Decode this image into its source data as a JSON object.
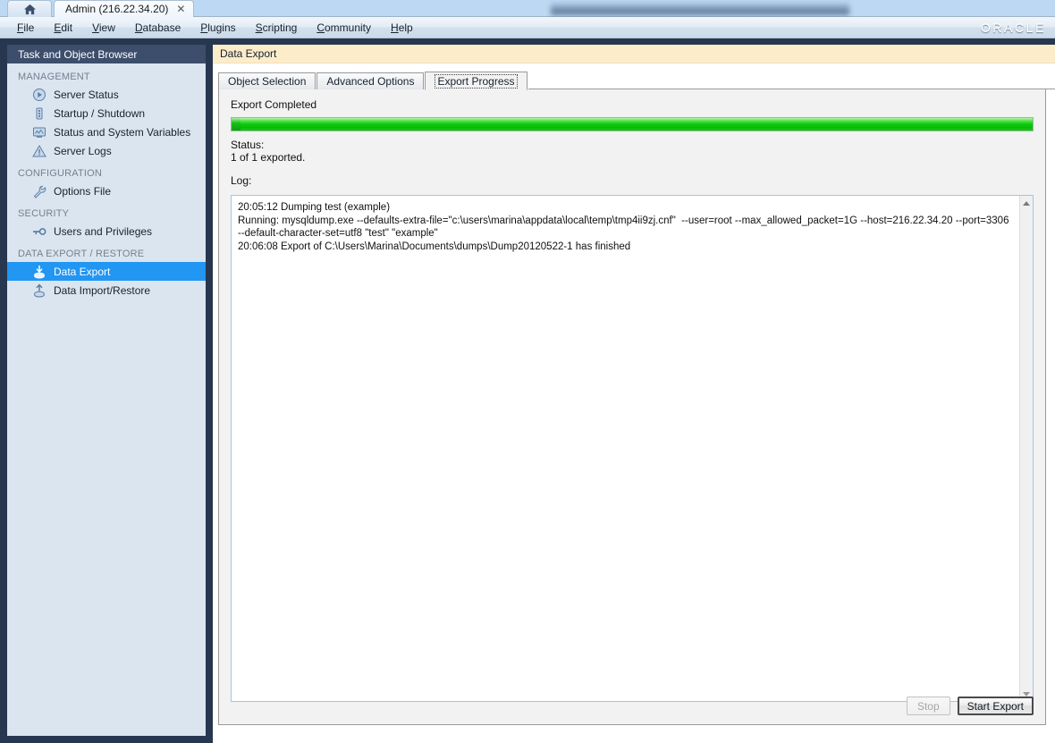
{
  "window": {
    "home_tab_icon": "home-icon",
    "document_tab_label": "Admin (216.22.34.20)",
    "tab_close_glyph": "✕"
  },
  "menubar": {
    "items": [
      {
        "pre": "",
        "accel": "F",
        "post": "ile"
      },
      {
        "pre": "",
        "accel": "E",
        "post": "dit"
      },
      {
        "pre": "",
        "accel": "V",
        "post": "iew"
      },
      {
        "pre": "",
        "accel": "D",
        "post": "atabase"
      },
      {
        "pre": "",
        "accel": "P",
        "post": "lugins"
      },
      {
        "pre": "",
        "accel": "S",
        "post": "cripting"
      },
      {
        "pre": "",
        "accel": "C",
        "post": "ommunity"
      },
      {
        "pre": "",
        "accel": "H",
        "post": "elp"
      }
    ],
    "brand": "ORACLE"
  },
  "sidebar": {
    "header": "Task and Object Browser",
    "sections": [
      {
        "label": "MANAGEMENT",
        "items": [
          {
            "label": "Server Status",
            "icon": "play-circle-icon",
            "selected": false
          },
          {
            "label": "Startup / Shutdown",
            "icon": "server-stack-icon",
            "selected": false
          },
          {
            "label": "Status and System Variables",
            "icon": "monitor-icon",
            "selected": false
          },
          {
            "label": "Server Logs",
            "icon": "warning-triangle-icon",
            "selected": false
          }
        ]
      },
      {
        "label": "CONFIGURATION",
        "items": [
          {
            "label": "Options File",
            "icon": "wrench-icon",
            "selected": false
          }
        ]
      },
      {
        "label": "SECURITY",
        "items": [
          {
            "label": "Users and Privileges",
            "icon": "key-icon",
            "selected": false
          }
        ]
      },
      {
        "label": "DATA EXPORT / RESTORE",
        "items": [
          {
            "label": "Data Export",
            "icon": "export-down-icon",
            "selected": true
          },
          {
            "label": "Data Import/Restore",
            "icon": "import-up-icon",
            "selected": false
          }
        ]
      }
    ]
  },
  "main": {
    "page_title": "Data Export",
    "tabs": [
      {
        "label": "Object Selection",
        "active": false
      },
      {
        "label": "Advanced Options",
        "active": false
      },
      {
        "label": "Export Progress",
        "active": true
      }
    ],
    "progress": {
      "heading": "Export Completed",
      "percent": 100,
      "bar_color": "#10c910"
    },
    "status_label": "Status:",
    "status_value": "1 of 1 exported.",
    "log_label": "Log:",
    "log_lines": [
      "20:05:12 Dumping test (example)",
      "Running: mysqldump.exe --defaults-extra-file=\"c:\\users\\marina\\appdata\\local\\temp\\tmp4ii9zj.cnf\"  --user=root --max_allowed_packet=1G --host=216.22.34.20 --port=3306 --default-character-set=utf8 \"test\" \"example\"",
      "20:06:08 Export of C:\\Users\\Marina\\Documents\\dumps\\Dump20120522-1 has finished"
    ],
    "buttons": {
      "stop_label": "Stop",
      "stop_enabled": false,
      "start_label": "Start Export",
      "start_enabled": true
    }
  }
}
